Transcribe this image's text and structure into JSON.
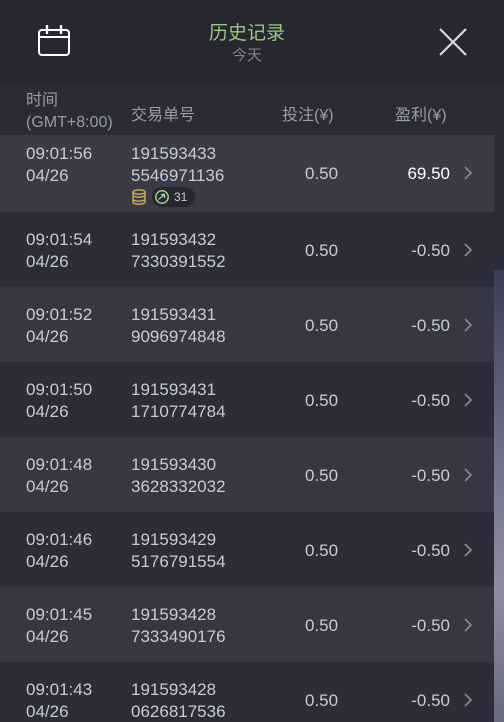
{
  "topbar": {
    "title": "历史记录",
    "subtitle": "今天",
    "calendar_icon": "calendar-icon",
    "close_icon": "close-icon"
  },
  "colors": {
    "title_green": "#96c978",
    "profit_win": "#ffffff"
  },
  "columns": {
    "time_line1": "时间",
    "time_line2": "(GMT+8:00)",
    "order": "交易单号",
    "bet": "投注(¥)",
    "profit": "盈利(¥)"
  },
  "rows": [
    {
      "time": "09:01:56",
      "date": "04/26",
      "order1": "191593433",
      "order2": "5546971136",
      "bet": "0.50",
      "profit": "69.50",
      "badge_count": "31"
    },
    {
      "time": "09:01:54",
      "date": "04/26",
      "order1": "191593432",
      "order2": "7330391552",
      "bet": "0.50",
      "profit": "-0.50"
    },
    {
      "time": "09:01:52",
      "date": "04/26",
      "order1": "191593431",
      "order2": "9096974848",
      "bet": "0.50",
      "profit": "-0.50"
    },
    {
      "time": "09:01:50",
      "date": "04/26",
      "order1": "191593431",
      "order2": "1710774784",
      "bet": "0.50",
      "profit": "-0.50"
    },
    {
      "time": "09:01:48",
      "date": "04/26",
      "order1": "191593430",
      "order2": "3628332032",
      "bet": "0.50",
      "profit": "-0.50"
    },
    {
      "time": "09:01:46",
      "date": "04/26",
      "order1": "191593429",
      "order2": "5176791554",
      "bet": "0.50",
      "profit": "-0.50"
    },
    {
      "time": "09:01:45",
      "date": "04/26",
      "order1": "191593428",
      "order2": "7333490176",
      "bet": "0.50",
      "profit": "-0.50"
    },
    {
      "time": "09:01:43",
      "date": "04/26",
      "order1": "191593428",
      "order2": "0626817536",
      "bet": "0.50",
      "profit": "-0.50"
    }
  ]
}
